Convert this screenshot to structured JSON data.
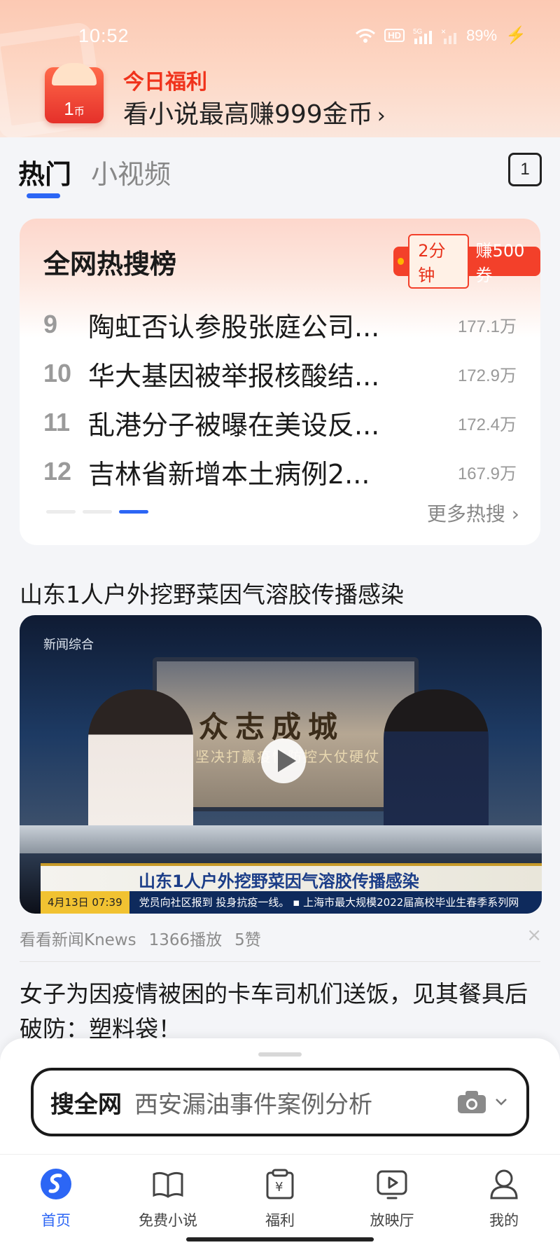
{
  "status_bar": {
    "time": "10:52",
    "network": "5G",
    "hd": "HD",
    "battery": "89%"
  },
  "welfare_banner": {
    "title": "今日福利",
    "subtitle": "看小说最高赚999金币",
    "coin_amount": "1",
    "coin_unit": "币"
  },
  "tabs": {
    "hot": "热门",
    "video": "小视频",
    "count": "1"
  },
  "hot_search": {
    "title": "全网热搜榜",
    "reward_time": "2分钟",
    "reward_text": "赚500券",
    "items": [
      {
        "rank": "9",
        "text": "陶虹否认参股张庭公司...",
        "heat": "177.1万"
      },
      {
        "rank": "10",
        "text": "华大基因被举报核酸结...",
        "heat": "172.9万"
      },
      {
        "rank": "11",
        "text": "乱港分子被曝在美设反...",
        "heat": "172.4万"
      },
      {
        "rank": "12",
        "text": "吉林省新增本土病例2...",
        "heat": "167.9万"
      }
    ],
    "more": "更多热搜"
  },
  "news1": {
    "title": "山东1人户外挖野菜因气溶胶传播感染",
    "video": {
      "channel": "新闻综合",
      "screen_text": "众志成城",
      "screen_sub": "坚决打赢疫情防控大仗硬仗",
      "lower_third": "山东1人户外挖野菜因气溶胶传播感染",
      "ticker_date": "4月13日 07:39",
      "ticker_text": "党员向社区报到 投身抗疫一线。 ▪ 上海市最大规模2022届高校毕业生春季系列网"
    },
    "source": "看看新闻Knews",
    "plays": "1366播放",
    "likes": "5赞",
    "close": "×"
  },
  "news2": {
    "title": "女子为因疫情被困的卡车司机们送饭，见其餐具后破防：塑料袋！"
  },
  "search": {
    "label": "搜全网",
    "query": "西安漏油事件案例分析"
  },
  "bottom_nav": {
    "items": [
      {
        "label": "首页",
        "icon": "home-logo-icon"
      },
      {
        "label": "免费小说",
        "icon": "book-icon"
      },
      {
        "label": "福利",
        "icon": "welfare-icon"
      },
      {
        "label": "放映厅",
        "icon": "play-icon"
      },
      {
        "label": "我的",
        "icon": "user-icon"
      }
    ]
  },
  "colors": {
    "accent": "#2c66f5",
    "red": "#f0331c",
    "banner_bg": "#fcc9b3"
  }
}
